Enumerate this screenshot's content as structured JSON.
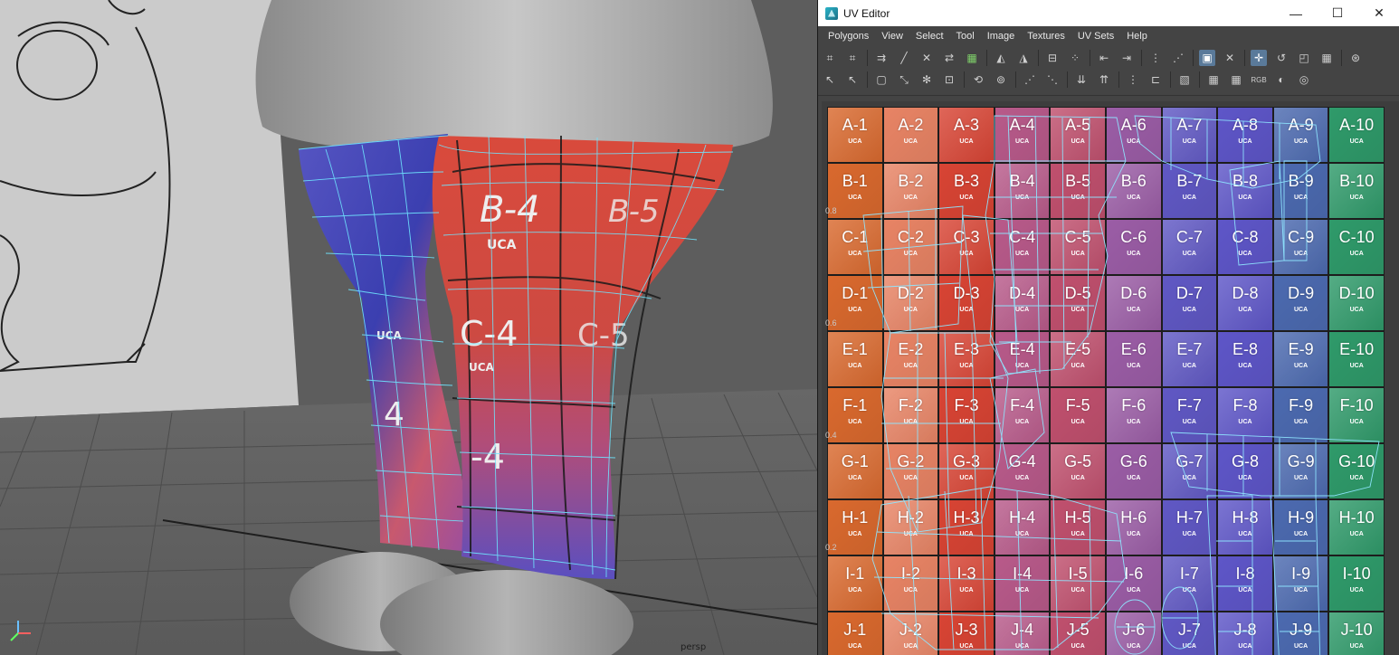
{
  "viewport": {
    "camera_label": "persp"
  },
  "uv_editor": {
    "title": "UV Editor",
    "window_buttons": [
      "—",
      "☐",
      "✕"
    ],
    "menu": [
      "Polygons",
      "View",
      "Select",
      "Tool",
      "Image",
      "Textures",
      "UV Sets",
      "Help"
    ],
    "toolbar_row1": [
      "⌗",
      "⌗",
      "",
      "⇉",
      "╱",
      "✕",
      "⇄",
      "▦",
      "",
      "◭",
      "◮",
      "",
      "⊟",
      "⁘",
      "",
      "⇤",
      "⇥",
      "",
      "⋮",
      "⋰",
      "",
      "▣",
      "✕",
      "",
      "✛",
      "↺",
      "◰",
      "▦",
      "",
      "⊛"
    ],
    "toolbar_row2": [
      "↖",
      "↖",
      "",
      "▢",
      "⤡",
      "✻",
      "⊡",
      "",
      "⟲",
      "⊚",
      "",
      "⋰",
      "⋱",
      "",
      "⇊",
      "⇈",
      "",
      "⋮",
      "⊏",
      "",
      "▧",
      "",
      "▦",
      "▦",
      "RGB",
      "◐",
      "◎"
    ],
    "axis_ticks": [
      "0.8",
      "0.6",
      "0.4",
      "0.2"
    ],
    "grid_rows": [
      "A",
      "B",
      "C",
      "D",
      "E",
      "F",
      "G",
      "H",
      "I",
      "J"
    ],
    "grid_cols": [
      "1",
      "2",
      "3",
      "4",
      "5",
      "6",
      "7",
      "8",
      "9",
      "10"
    ],
    "cell_sub": "UCA",
    "column_colors": [
      "#d9692e",
      "#e88465",
      "#d84434",
      "#b85a8a",
      "#c0506e",
      "#9b5da6",
      "#6058c4",
      "#5e56c8",
      "#4c6ab0",
      "#2f9a6a"
    ]
  }
}
